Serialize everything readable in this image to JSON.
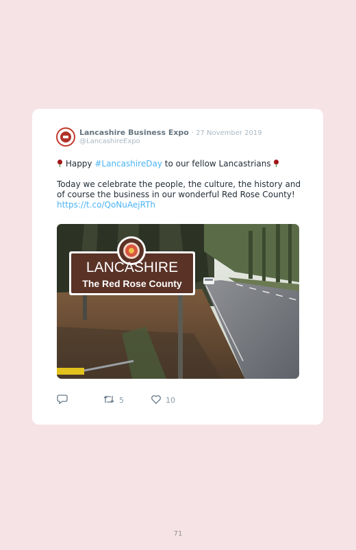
{
  "tweet": {
    "author_name": "Lancashire Business Expo",
    "date": "· 27 November 2019",
    "handle": "@LancashireExpo",
    "line1_pre": " Happy ",
    "line1_hashtag": "#LancashireDay",
    "line1_post": " to our fellow Lancastrians ",
    "body": "Today we celebrate the people, the culture, the history and of course the business in our wonderful Red Rose County!",
    "link": "https://t.co/QoNuAejRTh",
    "image": {
      "sign_title": "LANCASHIRE",
      "sign_subtitle": "The Red Rose County"
    },
    "actions": {
      "reply_count": "",
      "retweet_count": "5",
      "like_count": "10"
    }
  },
  "page_number": "71",
  "colors": {
    "background": "#f6e3e6",
    "card": "#ffffff",
    "link": "#4ab3f4",
    "sign": "#5a3226"
  },
  "icons": [
    "rose-emoji-icon",
    "reply-icon",
    "retweet-icon",
    "heart-icon"
  ]
}
